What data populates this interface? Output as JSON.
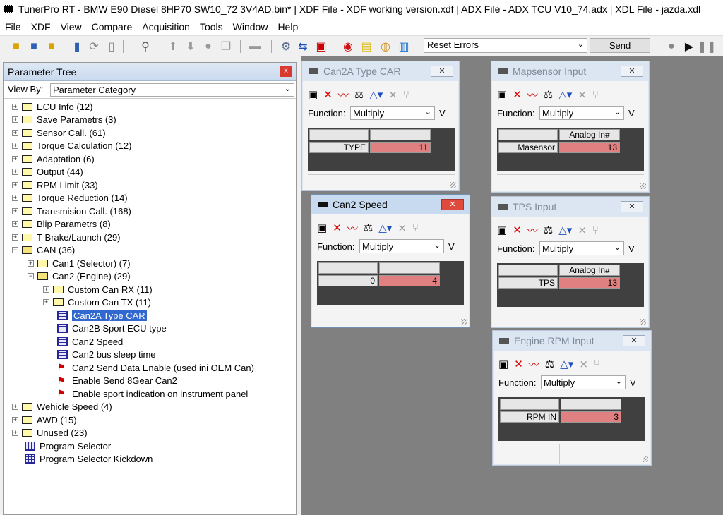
{
  "title": "TunerPro RT - BMW E90 Diesel 8HP70 SW10_72 3V4AD.bin* | XDF File - XDF working version.xdf | ADX File - ADX TCU V10_74.adx | XDL File - jazda.xdl",
  "menu": [
    "File",
    "XDF",
    "View",
    "Compare",
    "Acquisition",
    "Tools",
    "Window",
    "Help"
  ],
  "toolbar": {
    "reset_select": "Reset Errors",
    "send_label": "Send"
  },
  "tree": {
    "header": "Parameter Tree",
    "close": "x",
    "viewby_label": "View By:",
    "viewby_value": "Parameter Category",
    "nodes": [
      {
        "label": "ECU Info (12)"
      },
      {
        "label": "Save Parametrs (3)"
      },
      {
        "label": "Sensor Call. (61)"
      },
      {
        "label": "Torque Calculation (12)"
      },
      {
        "label": "Adaptation (6)"
      },
      {
        "label": "Output (44)"
      },
      {
        "label": "RPM Limit (33)"
      },
      {
        "label": "Torque Reduction (14)"
      },
      {
        "label": "Transmision Call. (168)"
      },
      {
        "label": "Blip Parametrs (8)"
      },
      {
        "label": "T-Brake/Launch (29)"
      },
      {
        "label": "CAN (36)"
      },
      {
        "label": "Can1 (Selector) (7)"
      },
      {
        "label": "Can2 (Engine) (29)"
      },
      {
        "label": "Custom Can RX (11)"
      },
      {
        "label": "Custom Can TX (11)"
      },
      {
        "label": "Can2A Type CAR"
      },
      {
        "label": "Can2B Sport ECU type"
      },
      {
        "label": "Can2 Speed"
      },
      {
        "label": "Can2 bus sleep time"
      },
      {
        "label": "Can2 Send Data Enable (used ini OEM Can)"
      },
      {
        "label": "Enable Send 8Gear Can2"
      },
      {
        "label": "Enable sport indication on instrument panel"
      },
      {
        "label": "Wehicle Speed (4)"
      },
      {
        "label": "AWD (15)"
      },
      {
        "label": "Unused (23)"
      },
      {
        "label": "Program Selector"
      },
      {
        "label": "Program Selector Kickdown"
      }
    ]
  },
  "windows": [
    {
      "title": "Can2A Type CAR",
      "function_label": "Function:",
      "function_value": "Multiply",
      "trail": "V",
      "col_header": "",
      "row_label": "TYPE",
      "value": "11"
    },
    {
      "title": "Mapsensor Input",
      "function_label": "Function:",
      "function_value": "Multiply",
      "trail": "V",
      "col_header": "Analog In#",
      "row_label": "Masensor",
      "value": "13"
    },
    {
      "title": "Can2 Speed",
      "function_label": "Function:",
      "function_value": "Multiply",
      "trail": "V",
      "col_header": "",
      "row_label": "0",
      "value": "4"
    },
    {
      "title": "TPS Input",
      "function_label": "Function:",
      "function_value": "Multiply",
      "trail": "V",
      "col_header": "Analog In#",
      "row_label": "TPS",
      "value": "13"
    },
    {
      "title": "Engine RPM Input",
      "function_label": "Function:",
      "function_value": "Multiply",
      "trail": "V",
      "col_header": "",
      "row_label": "RPM IN",
      "value": "3"
    }
  ],
  "win_close": "✕",
  "colors": {
    "selection": "#3068d0",
    "value_cell": "#e08080",
    "mdi_bg": "#808080"
  }
}
